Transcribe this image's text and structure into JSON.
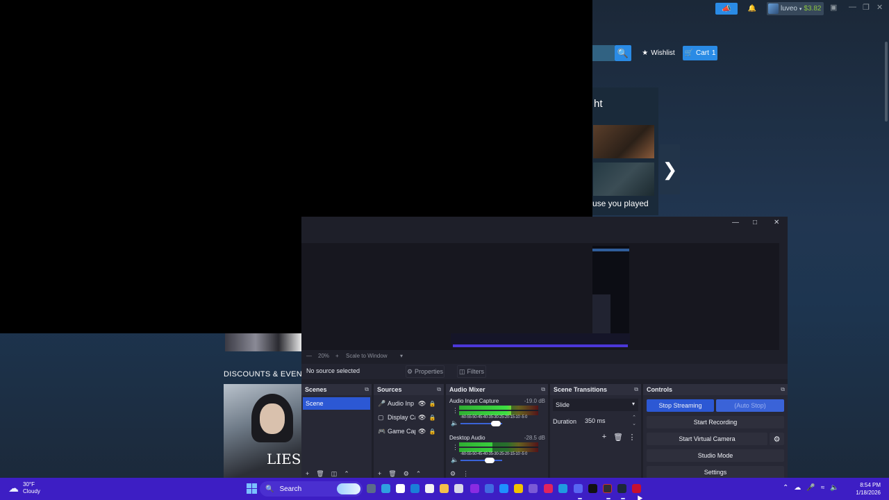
{
  "steam": {
    "account_name": "luveo",
    "account_balance": "$3.82",
    "wishlist_label": "Wishlist",
    "cart_label": "Cart",
    "cart_count": "1",
    "feature_title": "ht",
    "feature_caption": "use you played",
    "discounts_label": "DISCOUNTS & EVENTS",
    "poster_text": "LIES",
    "icons": {
      "announce": "megaphone-icon",
      "bell": "bell-icon",
      "search": "search-icon",
      "star": "star-icon",
      "cart": "cart-icon",
      "next": "chevron-right-icon"
    }
  },
  "obs": {
    "zoom": "20%",
    "scale_mode": "Scale to Window",
    "no_source": "No source selected",
    "properties_label": "Properties",
    "filters_label": "Filters",
    "docks": {
      "scenes": "Scenes",
      "sources": "Sources",
      "mixer": "Audio Mixer",
      "transitions": "Scene Transitions",
      "controls": "Controls"
    },
    "scenes": [
      "Scene"
    ],
    "sources": [
      {
        "name": "Audio Inp",
        "icon": "microphone-icon"
      },
      {
        "name": "Display Ca",
        "icon": "monitor-icon"
      },
      {
        "name": "Game Cap",
        "icon": "gamepad-icon"
      }
    ],
    "mixer": [
      {
        "name": "Audio Input Capture",
        "db": "-19.0 dB",
        "level": 0.66,
        "volume": 0.85
      },
      {
        "name": "Desktop Audio",
        "db": "-28.5 dB",
        "level": 0.42,
        "volume": 0.7
      }
    ],
    "meter_ticks": "-60-55-50-45-40-35-30-25-20-15-10 -5  0",
    "transition": {
      "type": "Slide",
      "duration_label": "Duration",
      "duration_value": "350 ms"
    },
    "controls": {
      "stop_streaming": "Stop Streaming",
      "auto_stop": "(Auto Stop)",
      "start_recording": "Start Recording",
      "start_virtual_camera": "Start Virtual Camera",
      "studio_mode": "Studio Mode",
      "settings": "Settings"
    }
  },
  "taskbar": {
    "temperature": "30°F",
    "weather": "Cloudy",
    "search_label": "Search",
    "time": "8:54 PM",
    "date": "1/18/2026"
  },
  "colors": {
    "steam_blue": "#2a8be5",
    "obs_accent": "#2c58d4",
    "taskbar": "#3d1ec4",
    "balance_green": "#8bc53f"
  }
}
